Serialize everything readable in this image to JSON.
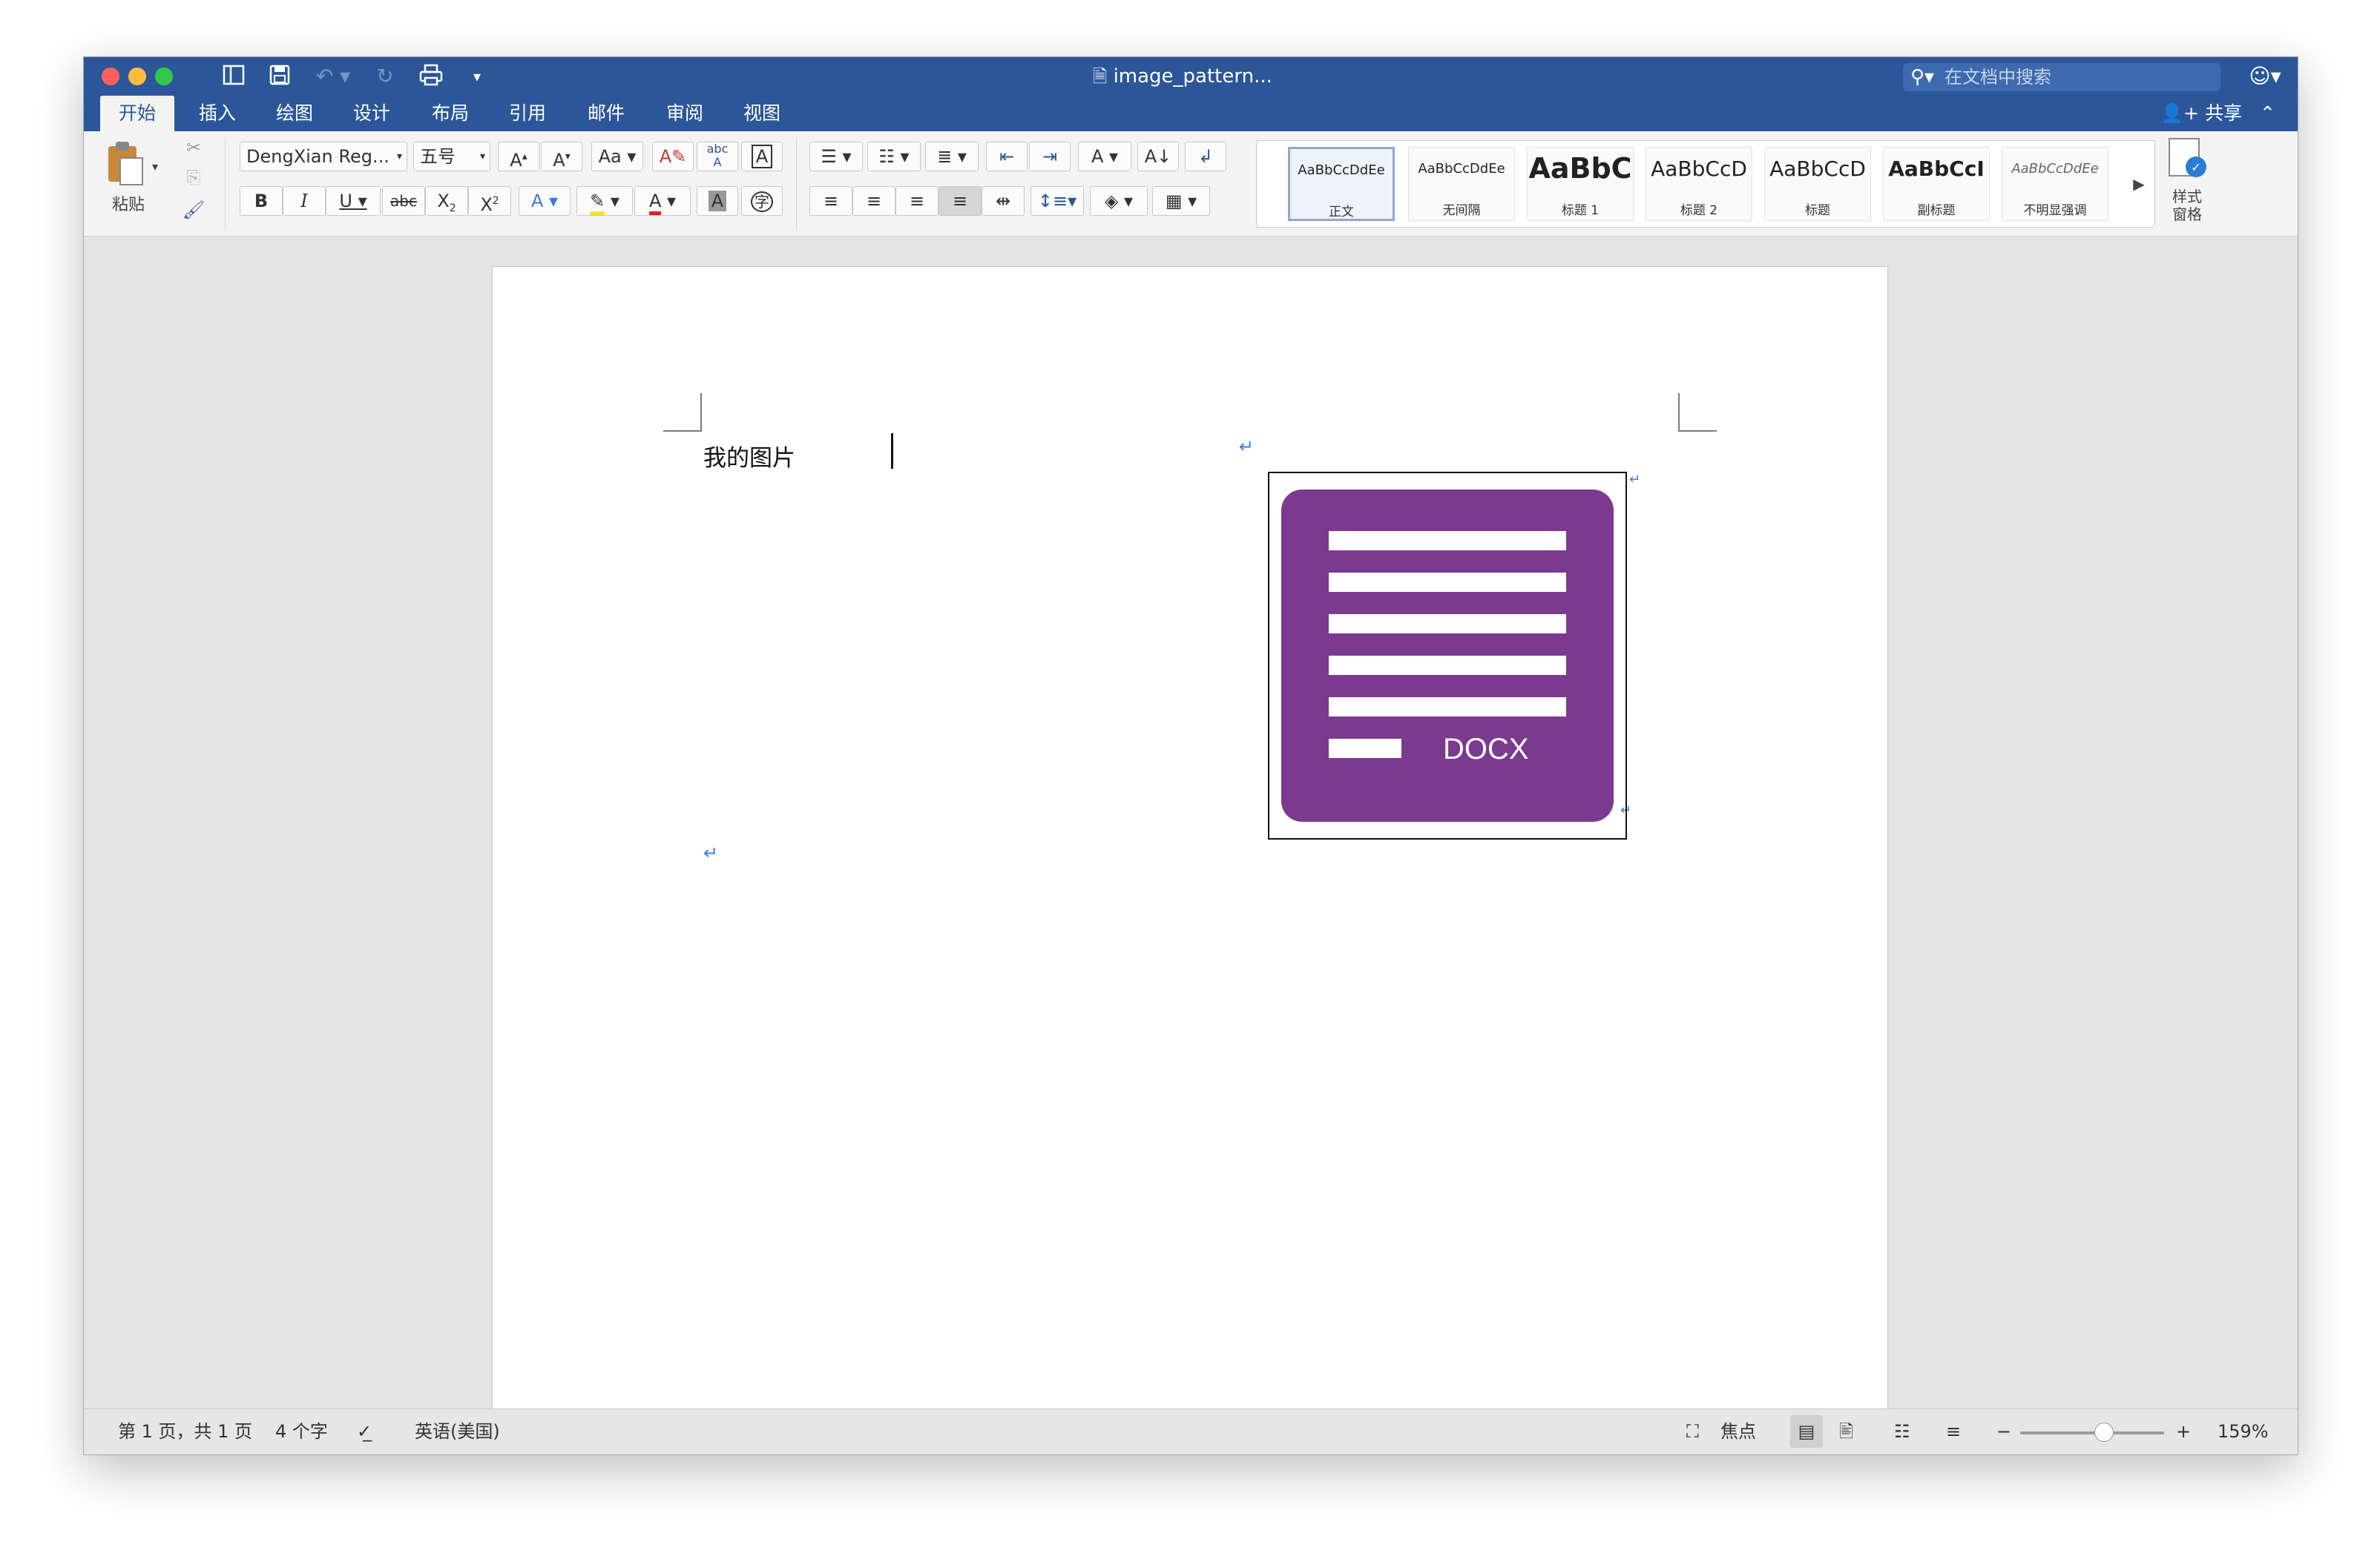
{
  "window": {
    "title": "image_pattern...",
    "search_placeholder": "在文档中搜索"
  },
  "tabs": [
    {
      "label": "开始",
      "active": true
    },
    {
      "label": "插入"
    },
    {
      "label": "绘图"
    },
    {
      "label": "设计"
    },
    {
      "label": "布局"
    },
    {
      "label": "引用"
    },
    {
      "label": "邮件"
    },
    {
      "label": "审阅"
    },
    {
      "label": "视图"
    }
  ],
  "share_label": "共享",
  "ribbon": {
    "paste_label": "粘贴",
    "font_name": "DengXian Reg...",
    "font_size": "五号",
    "text_effects_label": "A",
    "abc_label": "abc",
    "styles_pane_label": "样式\n窗格"
  },
  "styles": [
    {
      "sample": "AaBbCcDdEe",
      "name": "正文",
      "selected": true
    },
    {
      "sample": "AaBbCcDdEe",
      "name": "无间隔"
    },
    {
      "sample": "AaBbC",
      "name": "标题 1"
    },
    {
      "sample": "AaBbCcD",
      "name": "标题 2"
    },
    {
      "sample": "AaBbCcD",
      "name": "标题"
    },
    {
      "sample": "AaBbCcI",
      "name": "副标题"
    },
    {
      "sample": "AaBbCcDdEe",
      "name": "不明显强调"
    }
  ],
  "document": {
    "text": "我的图片",
    "image_label": "DOCX"
  },
  "status": {
    "page": "第 1 页，共 1 页",
    "words": "4 个字",
    "language": "英语(美国)",
    "focus": "焦点",
    "zoom": "159%",
    "zoom_fraction": 0.58
  },
  "colors": {
    "accent": "#2b579a",
    "docx_purple": "#7b3a8f"
  }
}
